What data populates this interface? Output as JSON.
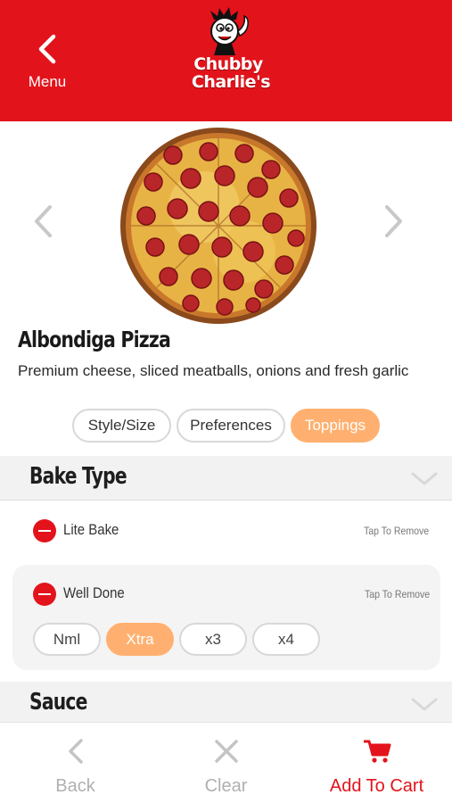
{
  "header": {
    "back_label": "Menu",
    "logo_line1": "Chubby",
    "logo_line2": "Charlie's"
  },
  "product": {
    "name": "Albondiga Pizza",
    "description": "Premium cheese, sliced meatballs, onions and fresh garlic"
  },
  "tabs": [
    {
      "label": "Style/Size",
      "active": false
    },
    {
      "label": "Preferences",
      "active": false
    },
    {
      "label": "Toppings",
      "active": true
    }
  ],
  "sections": [
    {
      "title": "Bake Type",
      "options": [
        {
          "name": "Lite Bake",
          "action": "Tap To Remove"
        },
        {
          "name": "Well Done",
          "action": "Tap To Remove",
          "amounts": [
            "Nml",
            "Xtra",
            "x3",
            "x4"
          ],
          "selected_amount": "Xtra"
        }
      ]
    },
    {
      "title": "Sauce"
    }
  ],
  "bottom_bar": {
    "back_label": "Back",
    "clear_label": "Clear",
    "add_label": "Add To Cart"
  },
  "colors": {
    "brand_red": "#e3131b",
    "accent_orange": "#ffb070",
    "inactive_gray": "#bfbfbf"
  },
  "icons": [
    "chevron-left-icon",
    "chevron-right-icon",
    "chevron-down-icon",
    "close-icon",
    "cart-icon",
    "mascot-icon"
  ]
}
